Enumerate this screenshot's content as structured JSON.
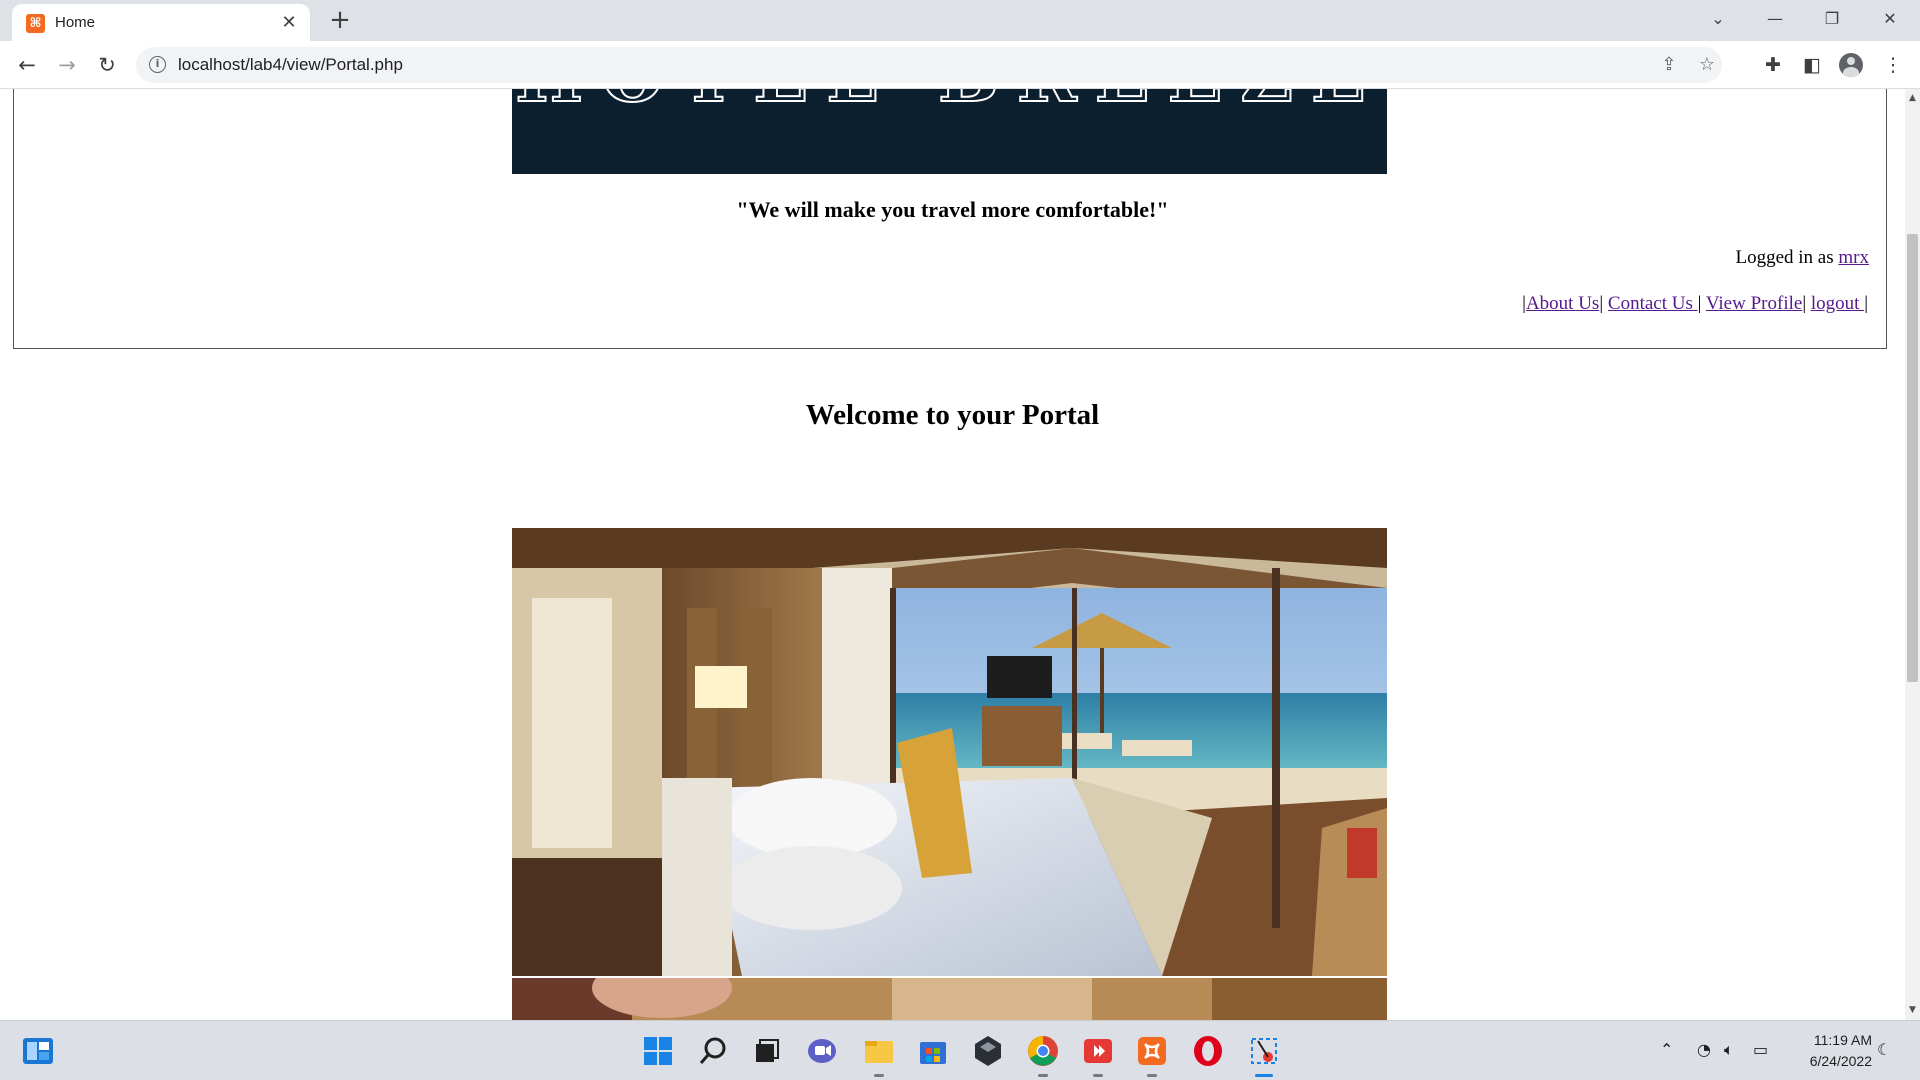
{
  "browser": {
    "tab_title": "Home",
    "tab_close": "✕",
    "new_tab": "+",
    "url": "localhost/lab4/view/Portal.php",
    "info_icon": "i",
    "window_controls": [
      "⌄",
      "—",
      "❐",
      "✕"
    ],
    "nav": {
      "back": "←",
      "forward": "→",
      "reload": "↻"
    }
  },
  "page": {
    "tagline": "\"We will make you travel more comfortable!\"",
    "logged_in_prefix": "Logged in as ",
    "username": "mrx",
    "nav_links": [
      "About Us",
      "Contact Us ",
      "View Profile",
      "logout "
    ],
    "welcome_heading": "Welcome to your Portal",
    "banner_text": "HOTEL BREEZE"
  },
  "taskbar": {
    "apps": [
      "start-icon",
      "search-icon",
      "task-view-icon",
      "chat-icon",
      "file-explorer-icon",
      "store-icon",
      "app-icon",
      "chrome-icon",
      "anydesk-icon",
      "xampp-icon",
      "opera-icon",
      "snipping-tool-icon"
    ],
    "time": "11:19 AM",
    "date": "6/24/2022"
  },
  "colors": {
    "link": "#551a8b",
    "banner_bg": "#0b1f2e",
    "tab_strip": "#dee1e6",
    "taskbar": "#dcdfe5"
  }
}
